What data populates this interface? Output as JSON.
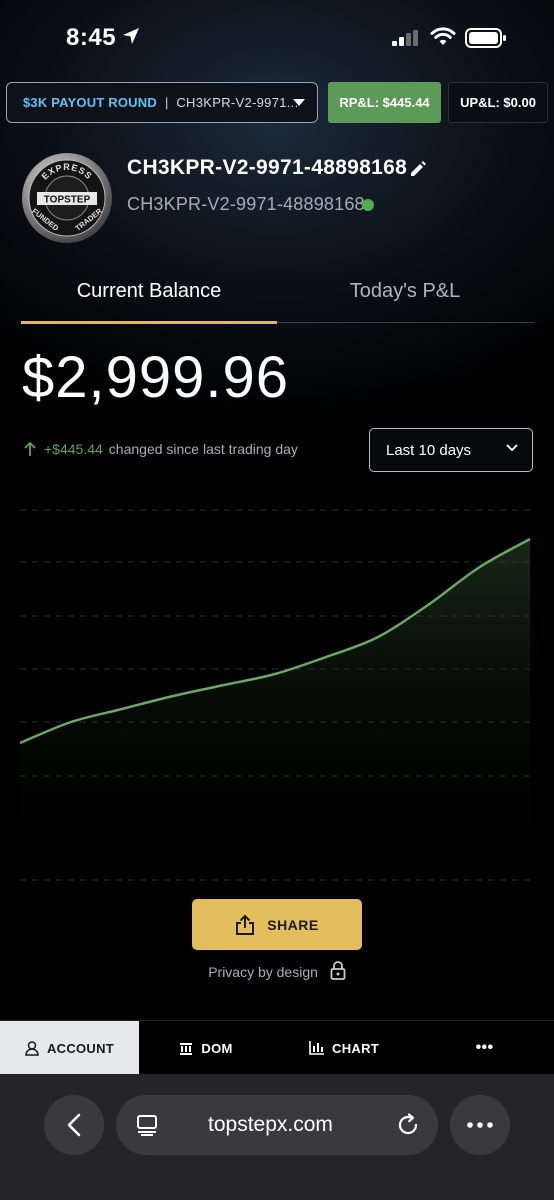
{
  "status_bar": {
    "time": "8:45"
  },
  "account_bar": {
    "payout_round": "$3K PAYOUT ROUND",
    "separator": "|",
    "account_short": "CH3KPR-V2-9971...",
    "rpl": "RP&L: $445.44",
    "upl": "UP&L: $0.00"
  },
  "header": {
    "logo_text": {
      "top": "EXPRESS",
      "middle": "TOPSTEP",
      "left": "FUNDED",
      "right": "TRADER"
    },
    "account_name": "CH3KPR-V2-9971-48898168",
    "account_id": "CH3KPR-V2-9971-48898168",
    "status_color": "#4caf50"
  },
  "tabs": [
    {
      "label": "Current Balance",
      "active": true
    },
    {
      "label": "Today's P&L",
      "active": false
    }
  ],
  "balance": "$2,999.96",
  "change": {
    "amount": "+$445.44",
    "text": "changed since last trading day"
  },
  "range_select": {
    "value": "Last 10 days"
  },
  "chart_data": {
    "type": "area",
    "series": [
      {
        "values": [
          2554,
          2596,
          2622,
          2648,
          2670,
          2692,
          2726,
          2765,
          2830,
          2905,
          2962
        ]
      }
    ],
    "ylim": [
      2280,
      3020
    ],
    "grid": true,
    "color": "#6aa865"
  },
  "share": {
    "label": "SHARE"
  },
  "privacy": "Privacy by design",
  "bottom_nav": [
    {
      "label": "ACCOUNT",
      "icon": "person-icon",
      "active": true
    },
    {
      "label": "DOM",
      "icon": "dom-icon",
      "active": false
    },
    {
      "label": "CHART",
      "icon": "chart-icon",
      "active": false
    },
    {
      "label": "•••",
      "icon": "more-icon",
      "active": false
    }
  ],
  "browser": {
    "url": "topstepx.com"
  },
  "colors": {
    "accent": "#e4be5c",
    "positive": "#5fa45a",
    "payout": "#5ec3f0"
  }
}
